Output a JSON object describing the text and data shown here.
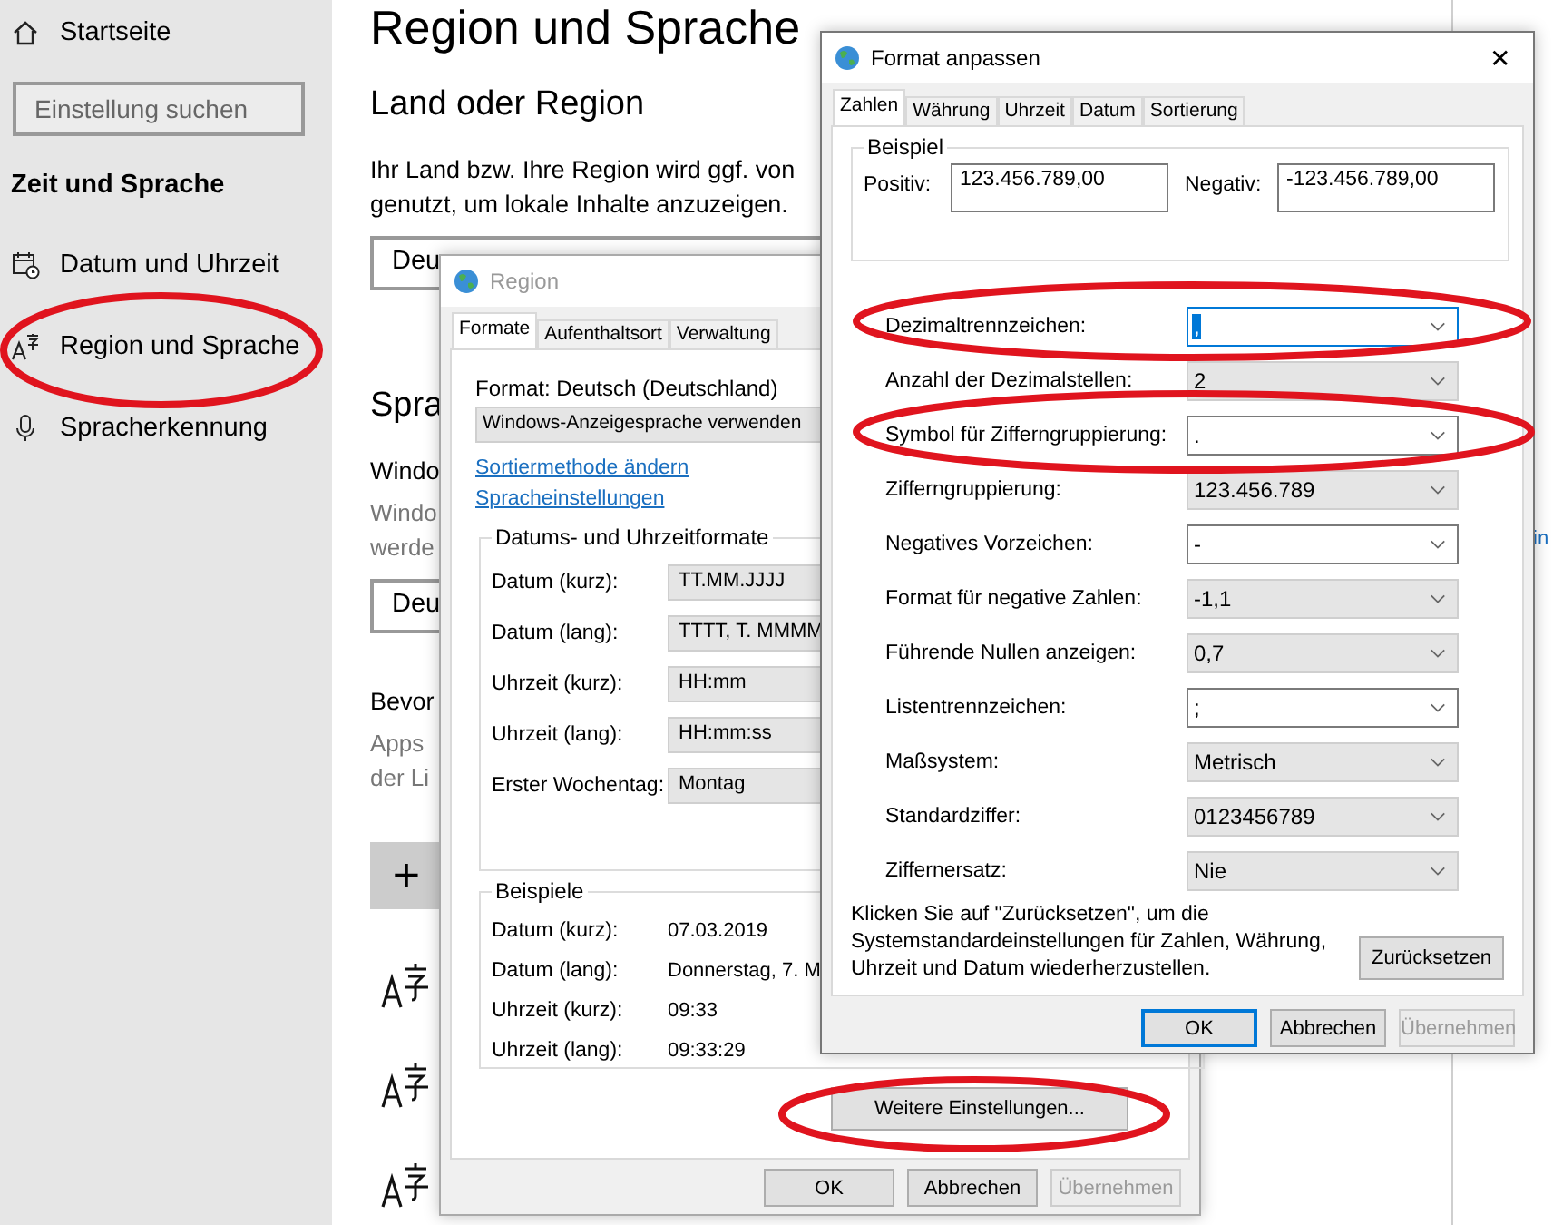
{
  "settings": {
    "nav": {
      "home": "Startseite",
      "search_placeholder": "Einstellung suchen",
      "section": "Zeit und Sprache",
      "items": [
        {
          "label": "Datum und Uhrzeit",
          "kind": "calendar"
        },
        {
          "label": "Region und Sprache",
          "kind": "language"
        },
        {
          "label": "Spracherkennung",
          "kind": "microphone"
        }
      ]
    },
    "content": {
      "title": "Region und Sprache",
      "country_heading": "Land oder Region",
      "country_text": [
        "Ihr Land bzw. Ihre Region wird ggf. von",
        "genutzt, um lokale Inhalte anzuzeigen."
      ],
      "country_value": "Deu",
      "language_heading": "Spra",
      "display_label": "Windo",
      "display_text": [
        "Windo",
        "werde"
      ],
      "display_value": "Deu",
      "preferred_heading": "Bevor",
      "preferred_text": [
        "Apps",
        "der Li"
      ],
      "add_button": "+"
    },
    "side_link": "in"
  },
  "region_dialog": {
    "title": "Region",
    "tabs": [
      {
        "label": "Formate",
        "selected": true
      },
      {
        "label": "Aufenthaltsort",
        "selected": false
      },
      {
        "label": "Verwaltung",
        "selected": false
      }
    ],
    "format_label": "Format: Deutsch (Deutschland)",
    "format_value": "Windows-Anzeigesprache verwenden",
    "links": [
      "Sortiermethode ändern",
      "Spracheinstellungen"
    ],
    "formats_group": "Datums- und Uhrzeitformate",
    "formats": [
      {
        "label": "Datum (kurz):",
        "value": "TT.MM.JJJJ"
      },
      {
        "label": "Datum (lang):",
        "value": "TTTT, T. MMMM"
      },
      {
        "label": "Uhrzeit (kurz):",
        "value": "HH:mm"
      },
      {
        "label": "Uhrzeit (lang):",
        "value": "HH:mm:ss"
      },
      {
        "label": "Erster Wochentag:",
        "value": "Montag"
      }
    ],
    "examples_group": "Beispiele",
    "examples": [
      {
        "label": "Datum (kurz):",
        "value": "07.03.2019"
      },
      {
        "label": "Datum (lang):",
        "value": "Donnerstag, 7. M"
      },
      {
        "label": "Uhrzeit (kurz):",
        "value": "09:33"
      },
      {
        "label": "Uhrzeit (lang):",
        "value": "09:33:29"
      }
    ],
    "more_button": "Weitere Einstellungen...",
    "buttons": [
      {
        "label": "OK",
        "default": false,
        "disabled": false
      },
      {
        "label": "Abbrechen",
        "default": false,
        "disabled": false
      },
      {
        "label": "Übernehmen",
        "default": false,
        "disabled": true
      }
    ]
  },
  "format_dialog": {
    "title": "Format anpassen",
    "close": "✕",
    "tabs": [
      {
        "label": "Zahlen",
        "selected": true
      },
      {
        "label": "Währung",
        "selected": false
      },
      {
        "label": "Uhrzeit",
        "selected": false
      },
      {
        "label": "Datum",
        "selected": false
      },
      {
        "label": "Sortierung",
        "selected": false
      }
    ],
    "example_group": "Beispiel",
    "positive_label": "Positiv:",
    "positive_value": "123.456.789,00",
    "negative_label": "Negativ:",
    "negative_value": "-123.456.789,00",
    "settings": [
      {
        "label": "Dezimaltrennzeichen:",
        "value": ",",
        "kind": "editable",
        "focused": true
      },
      {
        "label": "Anzahl der Dezimalstellen:",
        "value": "2",
        "kind": "list",
        "focused": false
      },
      {
        "label": "Symbol für Zifferngruppierung:",
        "value": ".",
        "kind": "editable",
        "focused": false
      },
      {
        "label": "Zifferngruppierung:",
        "value": "123.456.789",
        "kind": "list",
        "focused": false
      },
      {
        "label": "Negatives Vorzeichen:",
        "value": "-",
        "kind": "editable",
        "focused": false
      },
      {
        "label": "Format für negative Zahlen:",
        "value": "-1,1",
        "kind": "list",
        "focused": false
      },
      {
        "label": "Führende Nullen anzeigen:",
        "value": "0,7",
        "kind": "list",
        "focused": false
      },
      {
        "label": "Listentrennzeichen:",
        "value": ";",
        "kind": "editable",
        "focused": false
      },
      {
        "label": "Maßsystem:",
        "value": "Metrisch",
        "kind": "list",
        "focused": false
      },
      {
        "label": "Standardziffer:",
        "value": "0123456789",
        "kind": "list",
        "focused": false
      },
      {
        "label": "Ziffernersatz:",
        "value": "Nie",
        "kind": "list",
        "focused": false
      }
    ],
    "reset_text": "Klicken Sie auf \"Zurücksetzen\", um die Systemstandardeinstellungen für Zahlen, Währung, Uhrzeit und Datum wiederherzustellen.",
    "reset_button": "Zurücksetzen",
    "buttons": [
      {
        "label": "OK",
        "default": true,
        "disabled": false
      },
      {
        "label": "Abbrechen",
        "default": false,
        "disabled": false
      },
      {
        "label": "Übernehmen",
        "default": false,
        "disabled": true
      }
    ]
  }
}
